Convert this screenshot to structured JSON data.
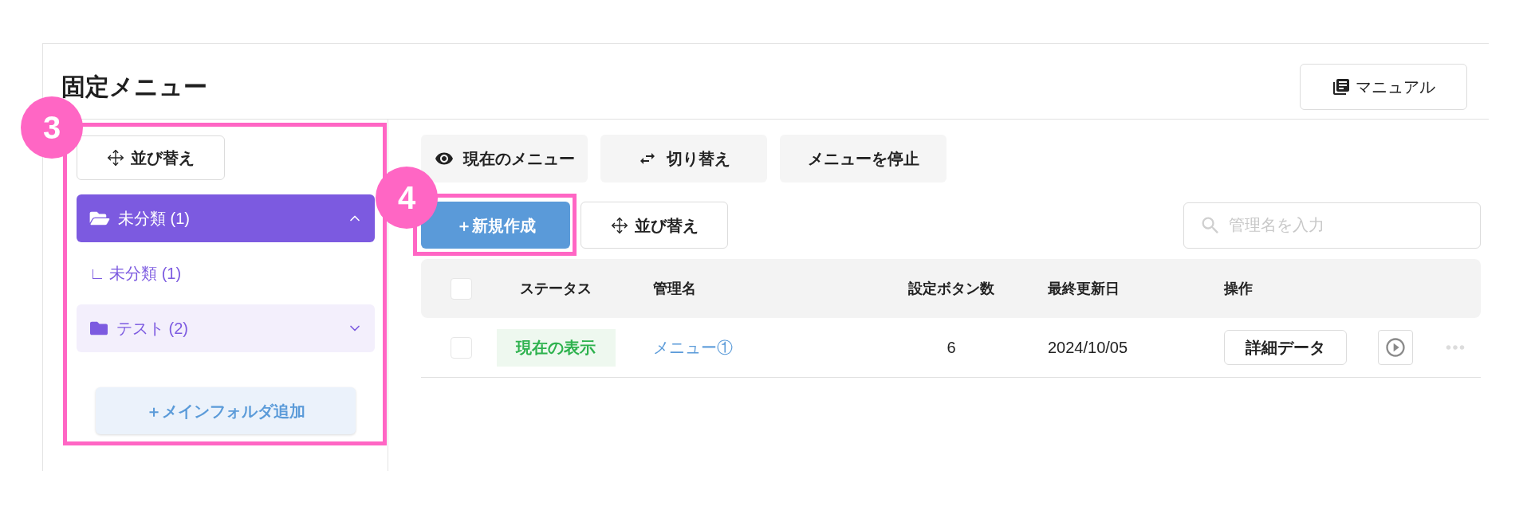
{
  "page": {
    "title": "固定メニュー",
    "manual_button": "マニュアル"
  },
  "sidebar": {
    "callout": "3",
    "sort_button": "並び替え",
    "folders": [
      {
        "label": "未分類 (1)",
        "selected": true,
        "expanded": true,
        "children": [
          {
            "label": "∟ 未分類 (1)"
          }
        ]
      },
      {
        "label": "テスト (2)",
        "selected": false,
        "expanded": false
      }
    ],
    "add_button": "＋メインフォルダ追加"
  },
  "toolbar": [
    {
      "label": "現在のメニュー",
      "kind": "view"
    },
    {
      "label": "切り替え",
      "kind": "swap"
    },
    {
      "label": "メニューを停止",
      "kind": "stop"
    }
  ],
  "actions": {
    "create_button": {
      "label": "＋新規作成",
      "callout": "4"
    },
    "sort_button": "並び替え",
    "search": {
      "placeholder": "管理名を入力"
    }
  },
  "table": {
    "header_checked": false,
    "columns": [
      "ステータス",
      "管理名",
      "設定ボタン数",
      "最終更新日",
      "操作"
    ],
    "rows": [
      {
        "checked": false,
        "status": "現在の表示",
        "name": "メニュー①",
        "button_count": "6",
        "updated": "2024/10/05",
        "detail_button": "詳細データ"
      }
    ]
  }
}
